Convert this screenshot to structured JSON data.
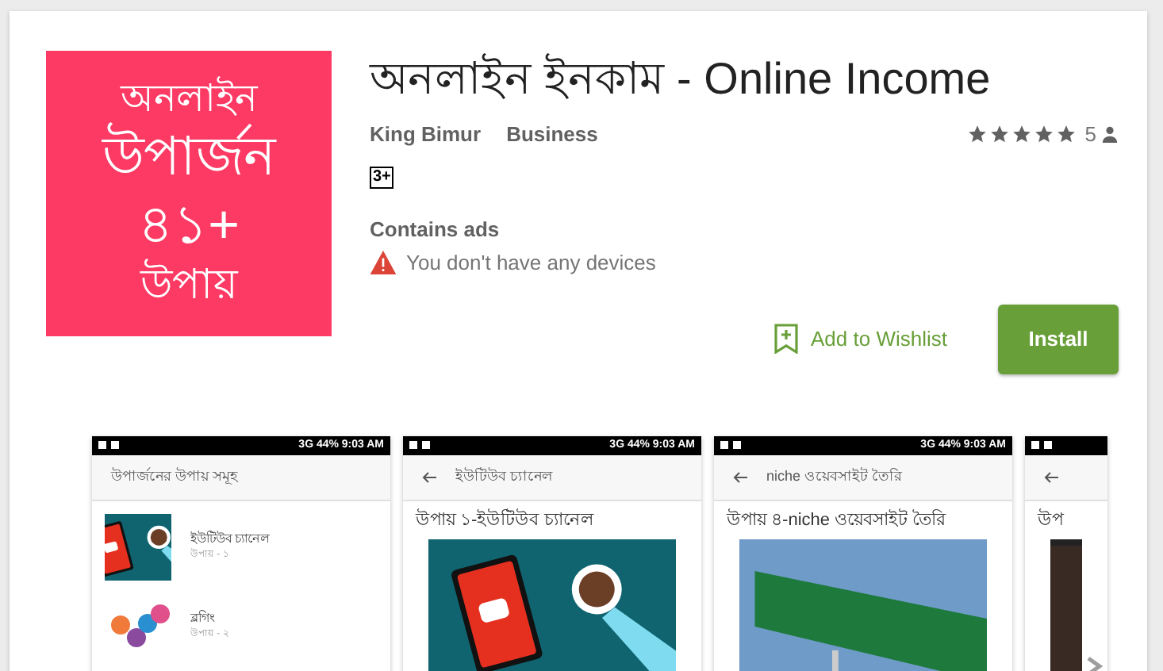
{
  "app_icon": {
    "lines": [
      "অনলাইন",
      "উপার্জন",
      "৪১+",
      "উপায়"
    ]
  },
  "title": "অনলাইন ইনকাম - Online Income",
  "developer": "King Bimur",
  "category": "Business",
  "rating": {
    "stars": 5,
    "count": "5"
  },
  "content_rating": "3+",
  "contains_ads": "Contains ads",
  "device_warning": "You don't have any devices",
  "wishlist_button": "Add to Wishlist",
  "install_button": "Install",
  "screenshots": [
    {
      "kind": "list",
      "status": "3G  44%  9:03 AM",
      "app_bar": "উপার্জনের উপায় সমূহ",
      "items": [
        {
          "title": "ইউটিউব চ্যানেল",
          "subtitle": "উপায় - ১"
        },
        {
          "title": "ব্লগিং",
          "subtitle": "উপায় - ২"
        }
      ]
    },
    {
      "kind": "detail",
      "status": "3G  44%  9:03 AM",
      "app_bar": "ইউটিউব চ্যানেল",
      "heading": "উপায় ১-ইউটিউব চ্যানেল"
    },
    {
      "kind": "detail",
      "status": "3G  44%  9:03 AM",
      "app_bar": "niche ওয়েবসাইট তৈরি",
      "heading": "উপায় ৪-niche ওয়েবসাইট তৈরি"
    },
    {
      "kind": "partial",
      "heading": "উপ"
    }
  ]
}
